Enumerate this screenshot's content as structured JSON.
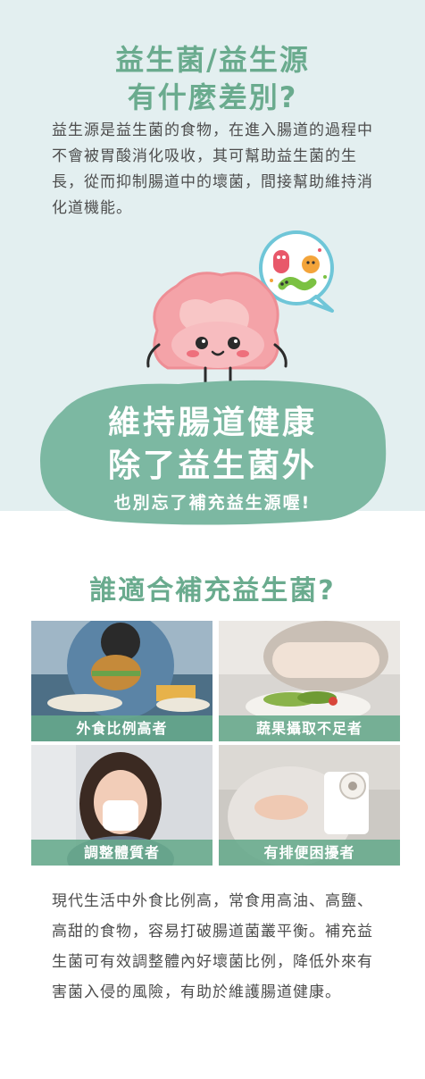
{
  "header": {
    "title_line1": "益生菌/益生源",
    "title_line2": "有什麼差別?"
  },
  "intro": {
    "text": "益生源是益生菌的食物，在進入腸道的過程中不會被胃酸消化吸收，其可幫助益生菌的生長，從而抑制腸道中的壞菌，間接幫助維持消化道機能。"
  },
  "banner": {
    "line1": "維持腸道健康",
    "line2": "除了益生菌外",
    "line3": "也別忘了補充益生源喔!"
  },
  "section2": {
    "title": "誰適合補充益生菌?",
    "cards": [
      {
        "label": "外食比例高者",
        "icon": "burger-eating-photo"
      },
      {
        "label": "蔬果攝取不足者",
        "icon": "salad-plate-photo"
      },
      {
        "label": "調整體質者",
        "icon": "sneezing-woman-photo"
      },
      {
        "label": "有排便困擾者",
        "icon": "stomach-ache-toilet-paper-photo"
      }
    ]
  },
  "bottom": {
    "text": "現代生活中外食比例高，常食用高油、高鹽、高甜的食物，容易打破腸道菌叢平衡。補充益生菌可有效調整體內好壞菌比例，降低外來有害菌入侵的風險，有助於維護腸道健康。"
  },
  "colors": {
    "accent_green": "#6aab8e",
    "top_background": "#e3eff0",
    "blob_green": "#7cb8a2",
    "intestine_pink": "#f4a3a8",
    "body_text": "#4d4d4d"
  }
}
